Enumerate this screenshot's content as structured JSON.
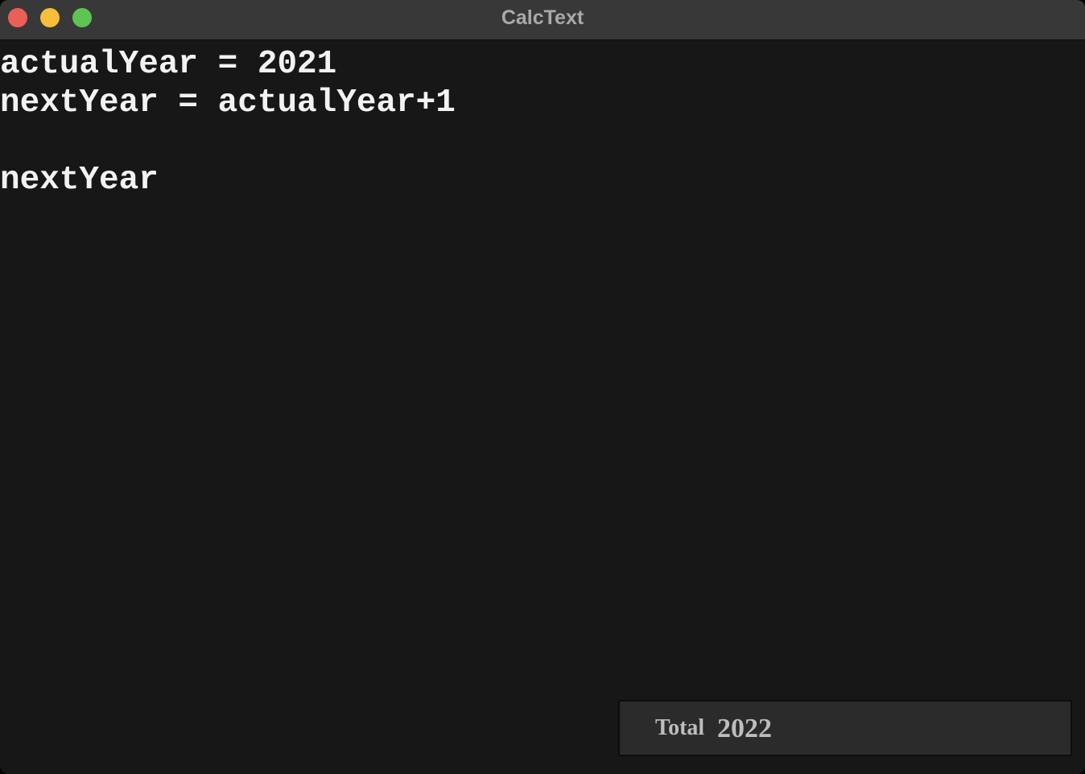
{
  "window": {
    "title": "CalcText"
  },
  "editor": {
    "lines": [
      "actualYear = 2021",
      "nextYear = actualYear+1",
      "",
      "nextYear"
    ]
  },
  "total": {
    "label": "Total",
    "value": "2022"
  },
  "colors": {
    "background": "#171717",
    "titlebar": "#383838",
    "close": "#ec5f57",
    "minimize": "#f6be3a",
    "maximize": "#5ec454",
    "text": "#f2f2f2",
    "total_box": "#2b2b2b"
  }
}
